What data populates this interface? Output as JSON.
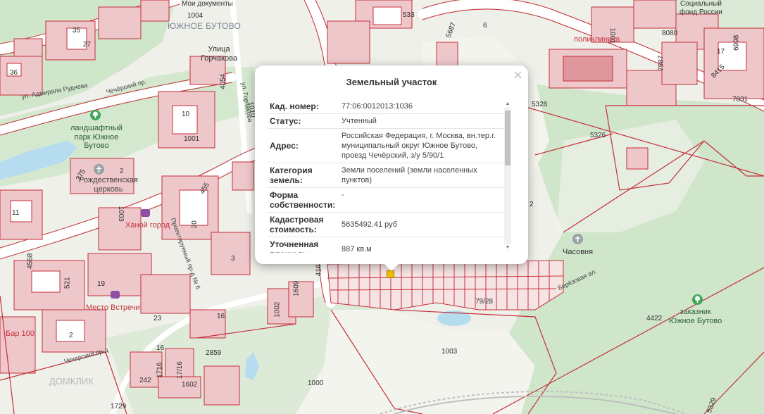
{
  "map": {
    "colors": {
      "background": "#eef0e9",
      "forest": "#cfe6cb",
      "parcel_stroke": "#c62f3a",
      "building_fill": "#eec7cb",
      "water": "#b5dcef",
      "road": "#f7f7f2"
    },
    "labels": {
      "district": "ЮЖНОЕ БУТОВО",
      "moi_docs": "Мои документы",
      "ulitsa_gorchakova": "Улица\nГорчакова",
      "ul_gorchakova": "ул. Горчакова",
      "ul_admirala": "ул. Адмирала Руднева",
      "chechersky": "Чечёрский пр.",
      "chernovsky": "Чечерский пр-д",
      "park": "ландшафтный\nпарк Южное\nБутово",
      "church": "Рождественская\nцерковь",
      "chasovnya": "Часовня",
      "zakaznik": "заказник\nЮжное Бутово",
      "poliklinika": "поликлиника",
      "soc_fond": "Социальный\nфонд России",
      "mesto": "Место Встречи",
      "bar": "Бар 100",
      "berezovaya": "Берёзовая ал.",
      "proektiruemy": "Проектируемый пр-д № 6",
      "mesto2": "Ханой город",
      "watermark": "ДОМКЛИК"
    },
    "numbers": {
      "n1004": "1004",
      "n533": "533",
      "n35": "35",
      "n27": "27",
      "n36": "36",
      "n4054": "4054",
      "n1010": "1010",
      "n10": "10",
      "n1001a": "1001",
      "n375": "375",
      "n2a": "2",
      "n11": "11",
      "n1003a": "1003",
      "n20": "20",
      "n455": "455",
      "n3": "3",
      "n4568": "4568",
      "n521": "521",
      "n19": "19",
      "n23": "23",
      "n2b": "2",
      "n16a": "16",
      "n16b": "16",
      "n2859": "2859",
      "n1716": "1716",
      "n1716b": "17/16",
      "n242": "242",
      "n1602": "1602",
      "n1729": "1729",
      "n1000": "1000",
      "n1003b": "1003",
      "n4422": "4422",
      "n7928": "79/28",
      "n5326": "5326",
      "n5328": "5328",
      "n5687": "5687",
      "n6": "6",
      "n1001b": "1001",
      "n8080": "8080",
      "n7987": "7987",
      "n17": "17",
      "n6998": "6998",
      "n8415": "8415",
      "n7031": "7031",
      "n1002": "1002",
      "n1609": "1609",
      "n416": "416",
      "n5329": "5329",
      "n2c": "2"
    }
  },
  "popup": {
    "title": "Земельный участок",
    "close": "×",
    "rows": [
      {
        "key": "Кад. номер:",
        "value": "77:06:0012013:1036"
      },
      {
        "key": "Статус:",
        "value": "Учтенный"
      },
      {
        "key": "Адрес:",
        "value": "Российская Федерация, г. Москва, вн.тер.г. муниципальный округ Южное Бутово, проезд Чечёрский, з/у 5/90/1"
      },
      {
        "key": "Категория земель:",
        "value": "Земли поселений (земли населенных пунктов)"
      },
      {
        "key": "Форма собственности:",
        "value": "-"
      },
      {
        "key": "Кадастровая стоимость:",
        "value": "5635492.41 руб"
      },
      {
        "key": "Уточненная площадь:",
        "value": "887 кв.м"
      }
    ],
    "scroll_position": 0.0
  }
}
